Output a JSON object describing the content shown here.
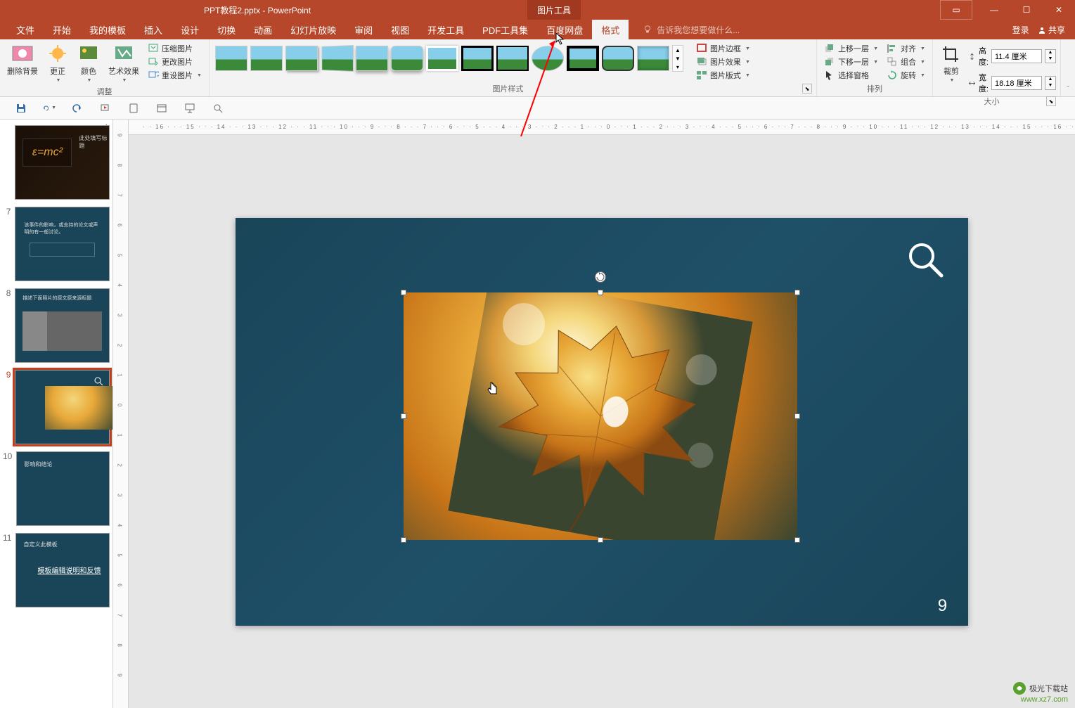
{
  "title_bar": {
    "document_title": "PPT教程2.pptx - PowerPoint",
    "contextual_tab": "图片工具"
  },
  "win_controls": {
    "ribbon_opts": "▭",
    "minimize": "—",
    "maximize": "☐",
    "close": "✕"
  },
  "menu": {
    "file": "文件",
    "home": "开始",
    "my_templates": "我的模板",
    "insert": "插入",
    "design": "设计",
    "transitions": "切换",
    "animations": "动画",
    "slideshow": "幻灯片放映",
    "review": "审阅",
    "view": "视图",
    "developer": "开发工具",
    "pdf_tools": "PDF工具集",
    "baidu": "百度网盘",
    "format": "格式",
    "tell_me": "告诉我您想要做什么...",
    "login": "登录",
    "share": "共享"
  },
  "ribbon": {
    "adjust": {
      "remove_bg": "删除背景",
      "corrections": "更正",
      "color": "颜色",
      "artistic": "艺术效果",
      "compress": "压缩图片",
      "change": "更改图片",
      "reset": "重设图片",
      "group_label": "调整"
    },
    "styles": {
      "border": "图片边框",
      "effects": "图片效果",
      "layout": "图片版式",
      "group_label": "图片样式"
    },
    "arrange": {
      "bring_forward": "上移一层",
      "send_backward": "下移一层",
      "selection_pane": "选择窗格",
      "align": "对齐",
      "group": "组合",
      "rotate": "旋转",
      "group_label": "排列"
    },
    "size": {
      "crop": "裁剪",
      "height_label": "高度:",
      "height_value": "11.4 厘米",
      "width_label": "宽度:",
      "width_value": "18.18 厘米",
      "group_label": "大小"
    }
  },
  "ruler": {
    "horizontal": "· · 16 · · · 15 · · · 14 · · · 13 · · · 12 · · · 11 · · · 10 · · · 9 · · · 8 · · · 7 · · · 6 · · · 5 · · · 4 · · · 3 · · · 2 · · · 1 · · · 0 · · · 1 · · · 2 · · · 3 · · · 4 · · · 5 · · · 6 · · · 7 · · · 8 · · · 9 · · · 10 · · · 11 · · · 12 · · · 13 · · · 14 · · · 15 · · · 16 · ·",
    "vertical": "9  8  7  6  5  4  3  2  1  0  1  2  3  4  5  6  7  8  9"
  },
  "thumbnails": [
    {
      "num": "",
      "title": "此处填写标题",
      "formula": "ε=mc²"
    },
    {
      "num": "7",
      "title": "该事件的影响，或支持的论文或声明的有一般讨论。"
    },
    {
      "num": "8",
      "title": "描述下面照片的原文原来源标题"
    },
    {
      "num": "9",
      "title": ""
    },
    {
      "num": "10",
      "title": "影响和结论"
    },
    {
      "num": "11",
      "title": "自定义此模板",
      "sub": "模板编辑说明和反馈"
    }
  ],
  "slide": {
    "current_number": "9"
  },
  "watermark": {
    "brand": "极光下载站",
    "url": "www.xz7.com"
  }
}
